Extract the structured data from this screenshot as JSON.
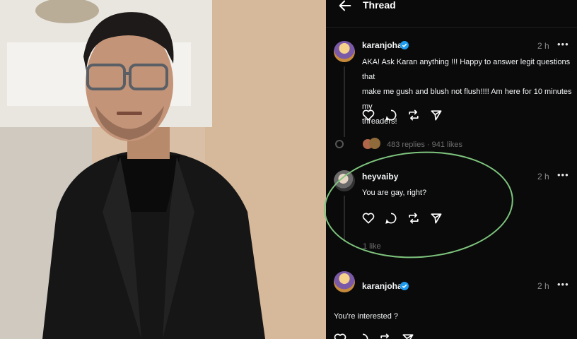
{
  "header": {
    "title": "Thread"
  },
  "posts": [
    {
      "username": "karanjohar",
      "time": "2 h",
      "text_lines": [
        "AKA! Ask Karan anything !!! Happy to answer legit questions that",
        "make me gush and blush not flush!!!! Am here for 10 minutes my",
        "threaders!"
      ],
      "stats": "483 replies · 941 likes"
    },
    {
      "username": "heyvaiby",
      "time": "2 h",
      "text": "You are gay, right?",
      "stats": "1 like"
    },
    {
      "username": "karanjohar",
      "time": "2 h",
      "text": "You're interested ?"
    }
  ],
  "more_label": "•••",
  "colors": {
    "highlight": "#7ec57e",
    "verified": "#1d9bf0",
    "background": "#0a0a0a"
  }
}
